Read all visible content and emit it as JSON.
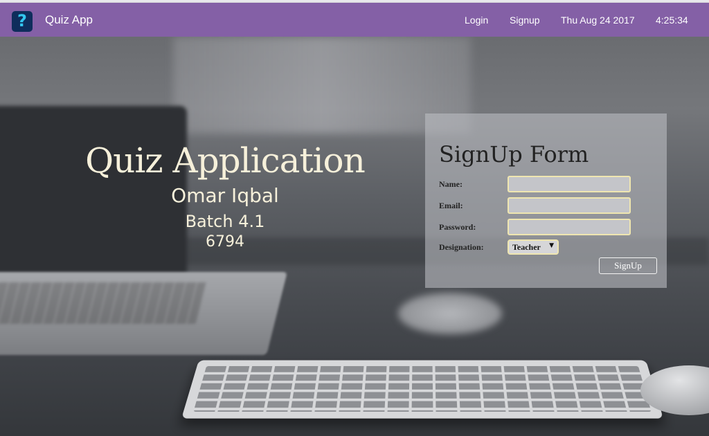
{
  "navbar": {
    "brand": "Quiz App",
    "logo_icon": "question-mark-icon",
    "login": "Login",
    "signup": "Signup",
    "date": "Thu Aug 24 2017",
    "time": "4:25:34",
    "color": "#8460a6"
  },
  "hero": {
    "title": "Quiz Application",
    "name": "Omar Iqbal",
    "batch": "Batch 4.1",
    "id": "6794"
  },
  "form": {
    "title": "SignUp Form",
    "name_label": "Name:",
    "email_label": "Email:",
    "password_label": "Password:",
    "designation_label": "Designation:",
    "designation_value": "Teacher",
    "submit": "SignUp"
  }
}
